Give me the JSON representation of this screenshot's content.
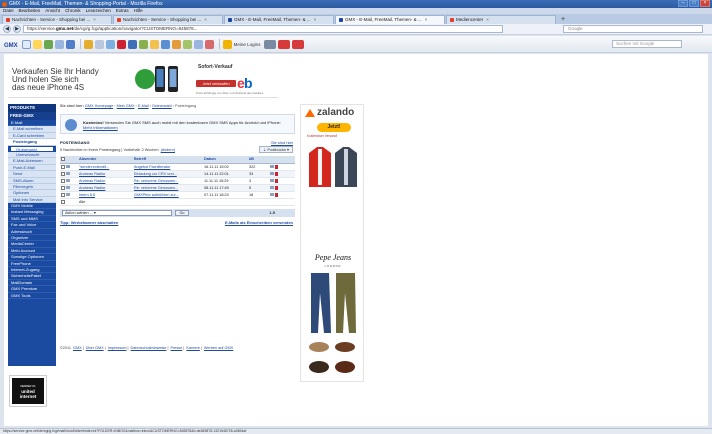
{
  "window": {
    "title": "GMX - E-Mail, FreeMail, Themen- & Shopping-Portal - Mozilla Firefox"
  },
  "menu": [
    "Datei",
    "Bearbeiten",
    "Ansicht",
    "Chronik",
    "Lesezeichen",
    "Extras",
    "Hilfe"
  ],
  "tabs": [
    {
      "label": "Nachrichten - Service - Shopping bei ...",
      "active": false
    },
    {
      "label": "Nachrichten - Service - Shopping bei ...",
      "active": false
    },
    {
      "label": "GMX - E-Mail, FreeMail, Themen- & ...",
      "active": false
    },
    {
      "label": "GMX - E-Mail, FreeMail, Themen- & ...",
      "active": true
    },
    {
      "label": "Mediencenter",
      "active": false
    }
  ],
  "nav": {
    "url_prefix": "https://service.",
    "url_domain": "gmx.net",
    "url_rest": "/de/cgi/g.fcgi/application/navigator?CUSTOMERNO=845878...",
    "search_placeholder": "Google"
  },
  "gmx_toolbar": {
    "logo": "GMX",
    "logins_label": "Meine Logins",
    "search_placeholder": "Suchen mit Google"
  },
  "promo": {
    "line1": "Verkaufen Sie Ihr Handy",
    "line2": "Und holen Sie sich",
    "line3": "das neue iPhone 4S",
    "sofort_label": "Sofort-Verkauf",
    "sofort_button": "Jetzt verkaufen",
    "ebay": "ebY",
    "fine_print": "Preis abhängig von Alter und Zustand des Gerätes"
  },
  "sidebar": {
    "head1": "PRODUKTE",
    "head2": "FREE-GMX",
    "items": [
      {
        "label": "E-Mail",
        "type": "main"
      },
      {
        "label": "E-Mail schreiben",
        "type": "sub"
      },
      {
        "label": "E-Card schreiben",
        "type": "sub"
      },
      {
        "label": "Posteingang",
        "type": "sub-sel"
      },
      {
        "label": "Ordnerwahl",
        "type": "sub-select"
      },
      {
        "label": "Unerwünscht",
        "type": "sub-indent"
      },
      {
        "label": "E-Mail-Adressen",
        "type": "sub"
      },
      {
        "label": "Push-E-Mail",
        "type": "sub"
      },
      {
        "label": "Send",
        "type": "sub"
      },
      {
        "label": "SMS-Alarm",
        "type": "sub"
      },
      {
        "label": "Filterregeln",
        "type": "sub"
      },
      {
        "label": "Optionen",
        "type": "sub"
      },
      {
        "label": "Mail Info Service",
        "type": "sub"
      },
      {
        "label": "GMX Mobile",
        "type": "main"
      },
      {
        "label": "Instant Messaging",
        "type": "main"
      },
      {
        "label": "SMS und MMS",
        "type": "main"
      },
      {
        "label": "Fax und Voice",
        "type": "main"
      },
      {
        "label": "Adressbuch",
        "type": "main"
      },
      {
        "label": "Organizer",
        "type": "main"
      },
      {
        "label": "MediaCenter",
        "type": "main"
      },
      {
        "label": "Mein Account",
        "type": "main"
      },
      {
        "label": "Sonstige Optionen",
        "type": "main"
      },
      {
        "label": "FreePhone",
        "type": "main"
      },
      {
        "label": "Internet-Zugang",
        "type": "main"
      },
      {
        "label": "SicherheitsPaket",
        "type": "main"
      },
      {
        "label": "MailDomain",
        "type": "main"
      },
      {
        "label": "GMX Premium",
        "type": "main"
      },
      {
        "label": "GMX Tools",
        "type": "main"
      }
    ]
  },
  "brand_logo": {
    "line1": "MEMBER OF",
    "line2": "united",
    "line3": "internet"
  },
  "main": {
    "breadcrumb_prefix": "Sie sind hier:",
    "breadcrumb": [
      "GMX Homepage",
      "Mein GMX",
      "E-Mail",
      "Ordnerwahl",
      "Posteingang"
    ],
    "info_bold": "Kostenlos!",
    "info_text": " Versenden Sie GMX SMS auch mobil mit den kostenlosen GMX SMS Apps für Android und iPhone: ",
    "info_link": "Mehr Informationen",
    "section_title": "POSTEINGANG",
    "section_link": "Sie sind hier",
    "msg_info": "5 Nachrichten in Ihrem Posteingang | Vorbehalt: 2 Wochen",
    "msg_info_link": "(ändern)",
    "archive_button": "Postbucks",
    "columns": [
      "Absender",
      "Betreff",
      "Datum",
      "kB"
    ],
    "rows": [
      {
        "sender": "\"sender.extendit...",
        "subject": "Angebot Fachliteratur",
        "date": "16.11.11 15:02",
        "size": "322"
      },
      {
        "sender": "Andreas Radior",
        "subject": "Einladung zur CRV und...",
        "date": "14.11.11 22:01",
        "size": "33"
      },
      {
        "sender": "Andreas Radior",
        "subject": "Re: verlorene Genussen...",
        "date": "11.11.11 15:29",
        "size": "3"
      },
      {
        "sender": "Andreas Radior",
        "subject": "Re: verlorene Genussen...",
        "date": "08.11.11 17:49",
        "size": "5"
      },
      {
        "sender": "Intern 8,5",
        "subject": "GMXPtrto aufmühlen zur...",
        "date": "07.11.11 18:24",
        "size": "18"
      }
    ],
    "select_all_label": "Alle",
    "select_placeholder": "Aktion wählen ...",
    "go_button": "Go",
    "page_count": "1-5",
    "tips_left": "Tipp: Werbebanner abschalten",
    "tips_right": "E-Mails als Einschreiben versenden"
  },
  "ad": {
    "zalando": "zalando",
    "jetzt": "Jetzt!",
    "kostenlos": "Kostenloser Versand!",
    "pepe": "Pepe Jeans",
    "pepe_sub": "LONDON"
  },
  "footer": {
    "copyright": "©2011",
    "links": [
      "GMX",
      "Über GMX",
      "Impressum",
      "Datenschutzhinweise",
      "Presse",
      "Karriere",
      "Werben auf GMX"
    ]
  },
  "statusbar": "https://service.gmx.net/de/cgi/g.fcgi/mail/inox/folder/folder.ini?FOLDER=INBOX&mailbox=inbox&CUSTOMERNO=845878&t=de845878.1321548726.a3694af"
}
